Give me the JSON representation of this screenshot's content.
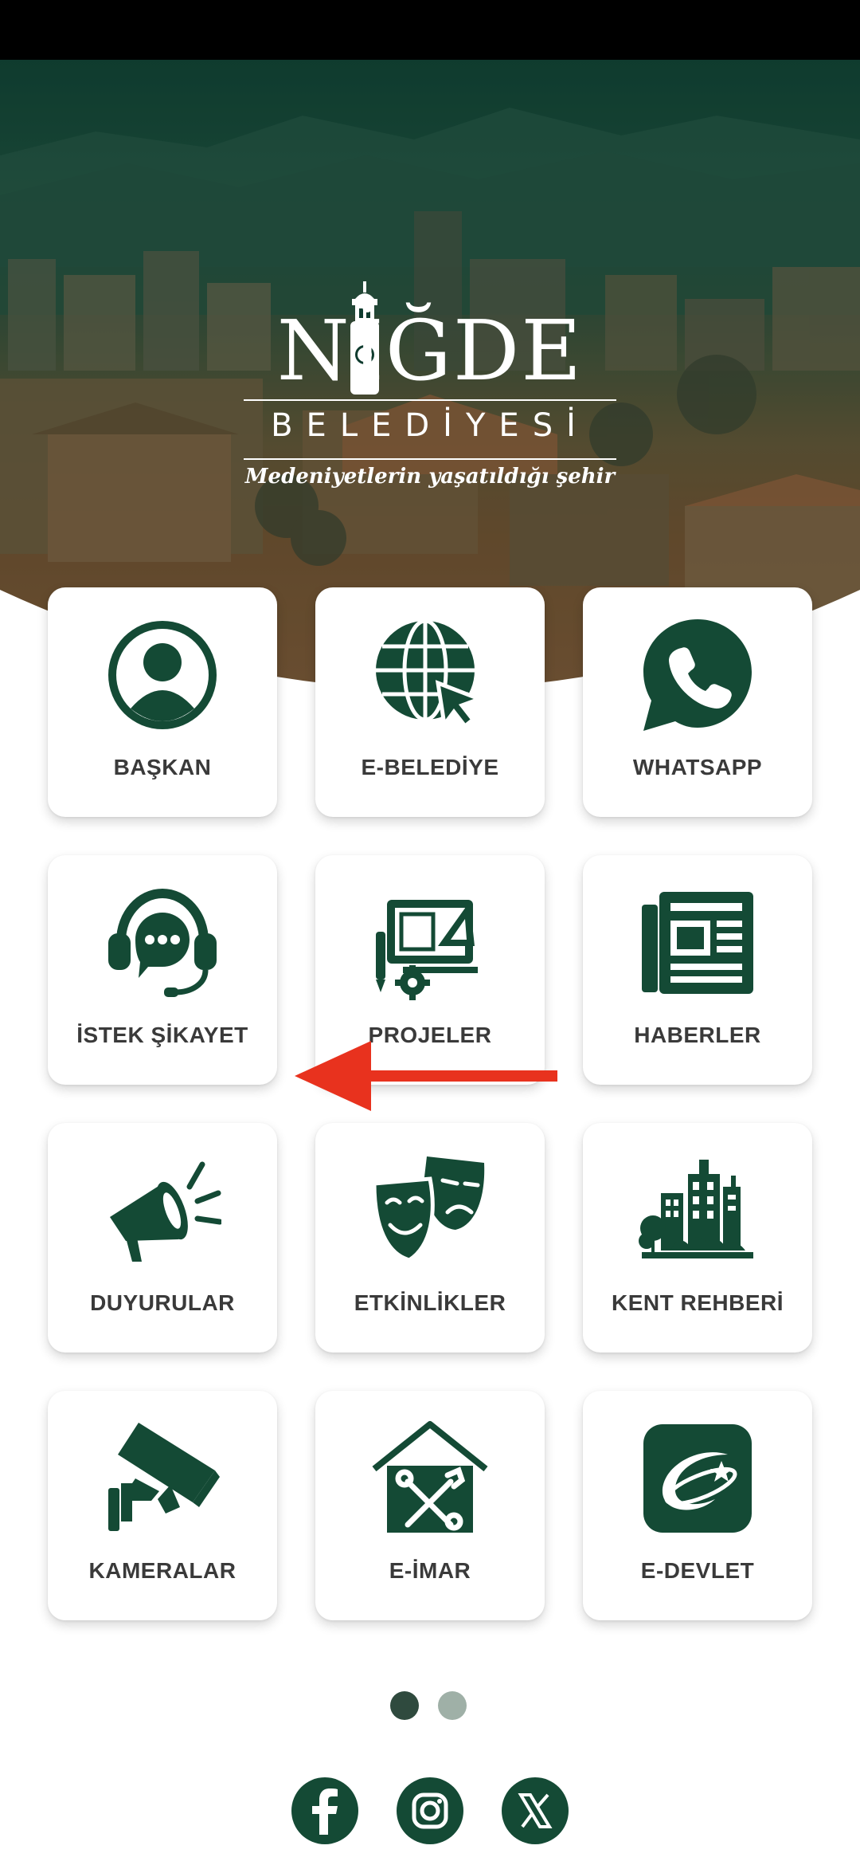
{
  "header": {
    "logo_title": "NİĞDE",
    "logo_subtitle": "BELEDİYESİ",
    "logo_slogan": "Medeniyetlerin yaşatıldığı şehir"
  },
  "menu": {
    "items": [
      {
        "label": "BAŞKAN",
        "icon": "user-circle-icon"
      },
      {
        "label": "E-BELEDİYE",
        "icon": "globe-cursor-icon"
      },
      {
        "label": "WHATSAPP",
        "icon": "whatsapp-icon"
      },
      {
        "label": "İSTEK ŞİKAYET",
        "icon": "headset-chat-icon"
      },
      {
        "label": "PROJELER",
        "icon": "blueprint-gear-icon"
      },
      {
        "label": "HABERLER",
        "icon": "newspaper-icon"
      },
      {
        "label": "DUYURULAR",
        "icon": "megaphone-icon"
      },
      {
        "label": "ETKİNLİKLER",
        "icon": "theater-masks-icon"
      },
      {
        "label": "KENT REHBERİ",
        "icon": "city-buildings-icon"
      },
      {
        "label": "KAMERALAR",
        "icon": "security-camera-icon"
      },
      {
        "label": "E-İMAR",
        "icon": "house-tools-icon"
      },
      {
        "label": "E-DEVLET",
        "icon": "e-devlet-logo-icon"
      }
    ]
  },
  "pagination": {
    "current": 1,
    "total": 2
  },
  "social": {
    "facebook": "facebook-icon",
    "instagram": "instagram-icon",
    "x": "x-twitter-icon"
  },
  "colors": {
    "brand_green": "#144a35",
    "label_gray": "#3a3a3a",
    "annotation_arrow": "#e8321e",
    "dot_active": "#2f4a3e",
    "dot_inactive": "#9fb0a7"
  }
}
